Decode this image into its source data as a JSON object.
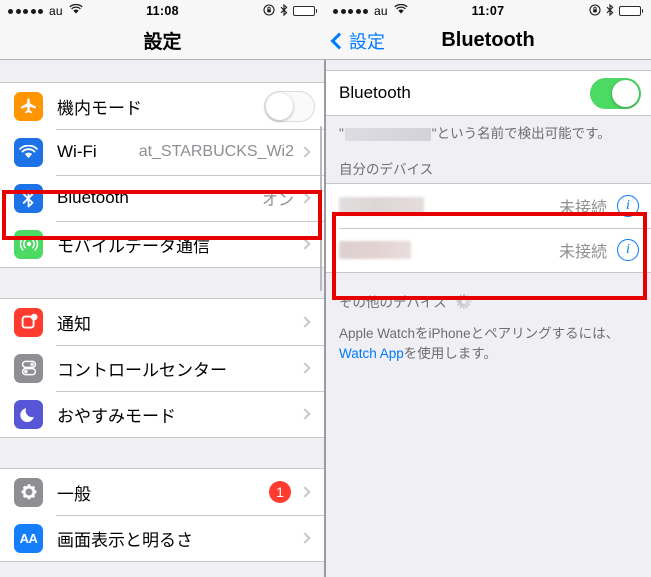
{
  "left": {
    "statusbar": {
      "signal_dots": 5,
      "carrier": "au",
      "wifi_icon": "wifi-icon",
      "time": "11:08",
      "rotation_lock_icon": "rotation-lock-icon",
      "bluetooth_icon": "bluetooth-status-icon",
      "battery_icon": "battery-full-icon"
    },
    "navbar": {
      "title": "設定"
    },
    "groups": [
      {
        "rows": [
          {
            "icon": "airplane-icon",
            "label": "機内モード",
            "accessory": "toggle",
            "toggle_on": false
          },
          {
            "icon": "wifi-icon",
            "label": "Wi-Fi",
            "accessory": "chevron",
            "value": "at_STARBUCKS_Wi2"
          },
          {
            "icon": "bluetooth-icon",
            "label": "Bluetooth",
            "accessory": "chevron",
            "value": "オン",
            "highlighted": true
          },
          {
            "icon": "cellular-icon",
            "label": "モバイルデータ通信",
            "accessory": "chevron",
            "value": ""
          }
        ]
      },
      {
        "rows": [
          {
            "icon": "notification-icon",
            "label": "通知",
            "accessory": "chevron",
            "value": ""
          },
          {
            "icon": "control-center-icon",
            "label": "コントロールセンター",
            "accessory": "chevron",
            "value": ""
          },
          {
            "icon": "moon-icon",
            "label": "おやすみモード",
            "accessory": "chevron",
            "value": ""
          }
        ]
      },
      {
        "rows": [
          {
            "icon": "gear-icon",
            "label": "一般",
            "accessory": "chevron",
            "value": "",
            "badge": "1"
          },
          {
            "icon": "display-icon",
            "label": "画面表示と明るさ",
            "accessory": "chevron",
            "value": ""
          }
        ]
      }
    ]
  },
  "right": {
    "statusbar": {
      "signal_dots": 5,
      "carrier": "au",
      "wifi_icon": "wifi-icon",
      "time": "11:07",
      "rotation_lock_icon": "rotation-lock-icon",
      "bluetooth_icon": "bluetooth-status-icon",
      "battery_icon": "battery-full-icon"
    },
    "navbar": {
      "back_label": "設定",
      "title": "Bluetooth"
    },
    "bluetooth_row": {
      "label": "Bluetooth",
      "toggle_on": true
    },
    "discoverable_caption": {
      "prefix": "\"",
      "device_name_redacted": "",
      "suffix": "\"という名前で検出可能です。"
    },
    "my_devices": {
      "header": "自分のデバイス",
      "devices": [
        {
          "name_redacted": "",
          "status": "未接続",
          "info_icon": "info-circle-icon"
        },
        {
          "name_redacted": "",
          "status": "未接続",
          "info_icon": "info-circle-icon"
        }
      ]
    },
    "other_devices": {
      "header": "その他のデバイス",
      "spinner_icon": "activity-spinner-icon"
    },
    "watch_footnote": {
      "line1": "Apple WatchをiPhoneとペアリングするには、",
      "link": "Watch App",
      "line2": "を使用します。"
    }
  },
  "annotations": {
    "red_box_color": "#e60000",
    "boxes": [
      {
        "name": "bluetooth-row-highlight"
      },
      {
        "name": "my-devices-highlight"
      }
    ]
  }
}
